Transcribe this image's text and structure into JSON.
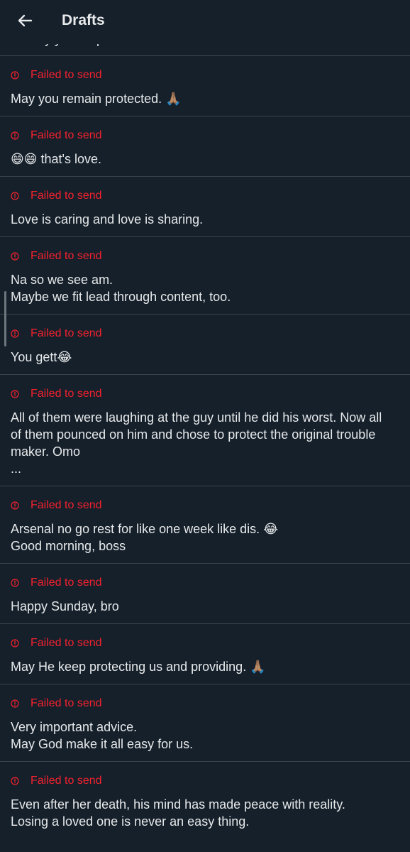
{
  "header": {
    "title": "Drafts",
    "back_icon": "arrow-left-icon"
  },
  "peek_text": "… may you be protected",
  "status_color": "#f4212e",
  "drafts": [
    {
      "status": "Failed to send",
      "lines": [
        "May you remain protected. 🙏🏽"
      ]
    },
    {
      "status": "Failed to send",
      "lines": [
        "😄😄 that's love."
      ]
    },
    {
      "status": "Failed to send",
      "lines": [
        "Love is caring and love is sharing."
      ]
    },
    {
      "status": "Failed to send",
      "lines": [
        "Na so we see am.",
        "Maybe we fit lead through content, too."
      ]
    },
    {
      "status": "Failed to send",
      "lines": [
        "You gett😂"
      ]
    },
    {
      "status": "Failed to send",
      "lines": [
        "All of them were laughing at the guy until he did his worst. Now all",
        "of them pounced on him and chose to protect the original trouble",
        "maker. Omo",
        "..."
      ]
    },
    {
      "status": "Failed to send",
      "lines": [
        "Arsenal no go rest for like one week like dis. 😂",
        "Good morning, boss"
      ]
    },
    {
      "status": "Failed to send",
      "lines": [
        "Happy Sunday, bro"
      ]
    },
    {
      "status": "Failed to send",
      "lines": [
        "May He keep protecting us and providing. 🙏🏽"
      ]
    },
    {
      "status": "Failed to send",
      "lines": [
        "Very important advice.",
        "May God make it all easy for us."
      ]
    },
    {
      "status": "Failed to send",
      "lines": [
        "Even after her death, his mind has made peace with reality.",
        "Losing a loved one is never an easy thing."
      ]
    }
  ]
}
